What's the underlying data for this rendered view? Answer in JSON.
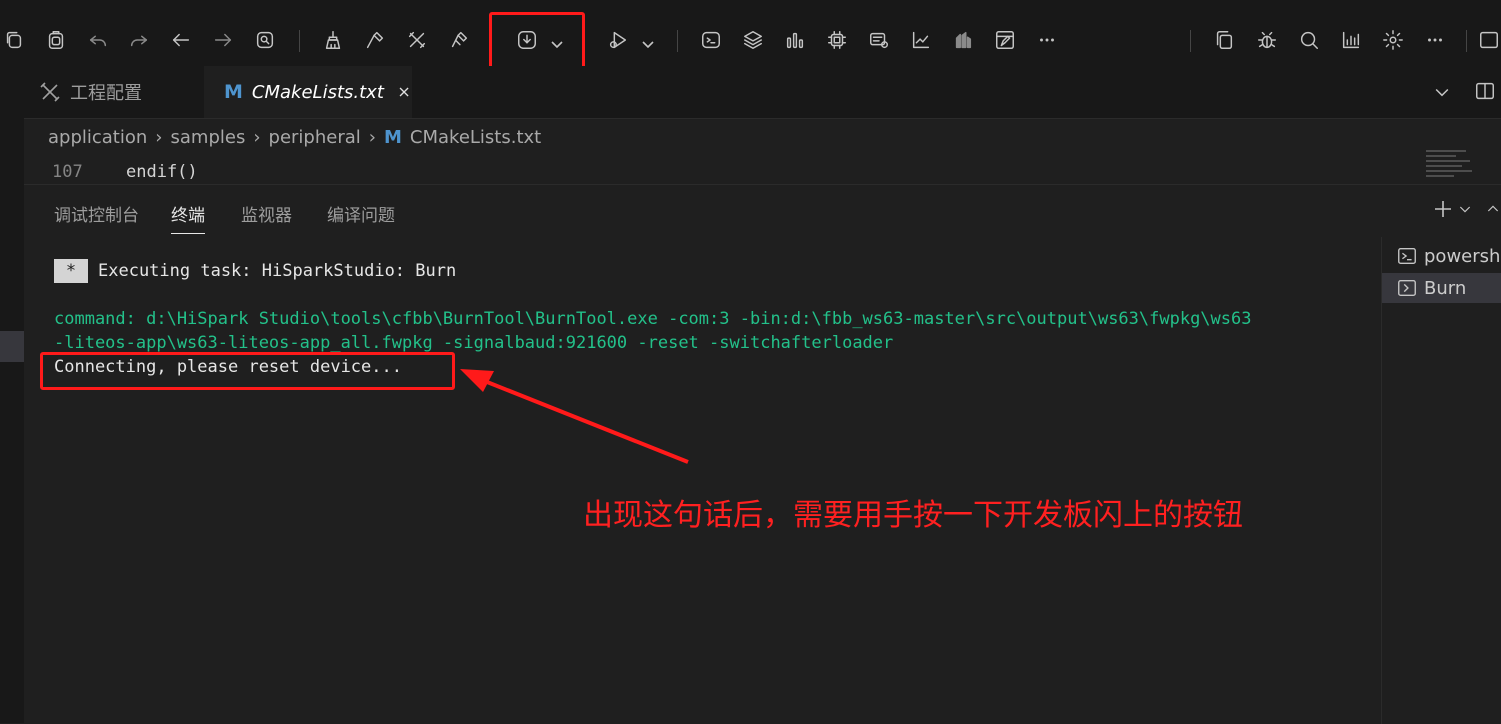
{
  "toolbar": {
    "icons_left": [
      "copy-icon",
      "paste-icon",
      "undo-icon",
      "redo-icon",
      "back-arrow-icon",
      "forward-arrow-icon",
      "find-in-files-icon"
    ],
    "icons_build": [
      "clean-icon",
      "build-icon",
      "rebuild-icon",
      "build-all-icon"
    ],
    "burn_button": "burn-download-icon",
    "debug_button": "debug-run-icon",
    "icons_tools": [
      "terminal-icon",
      "stack-icon",
      "chart-bars-icon",
      "chip-icon",
      "device-config-icon",
      "trend-icon",
      "memory-icon",
      "editor-icon",
      "more-icon"
    ],
    "icons_right": [
      "duplicate-icon",
      "bug-icon",
      "search-icon",
      "stats-icon",
      "gear-icon",
      "more-icon",
      "panel-icon"
    ]
  },
  "tabs": [
    {
      "label": "工程配置",
      "icon": "tools-icon",
      "active": false
    },
    {
      "label": "CMakeLists.txt",
      "icon": "M",
      "active": true
    }
  ],
  "breadcrumb": [
    "application",
    "samples",
    "peripheral",
    "CMakeLists.txt"
  ],
  "breadcrumb_file_icon": "M",
  "editor": {
    "line_number": "107",
    "code": "endif()"
  },
  "panel": {
    "tabs": [
      "调试控制台",
      "终端",
      "监视器",
      "编译问题"
    ],
    "active_tab": "终端"
  },
  "terminal": {
    "task_badge": "*",
    "task_line": "Executing task: HiSparkStudio: Burn",
    "command_line1": "command: d:\\HiSpark Studio\\tools\\cfbb\\BurnTool\\BurnTool.exe -com:3 -bin:d:\\fbb_ws63-master\\src\\output\\ws63\\fwpkg\\ws63",
    "command_line2": "-liteos-app\\ws63-liteos-app_all.fwpkg -signalbaud:921600 -reset -switchafterloader",
    "status_line": "Connecting, please reset device..."
  },
  "terminal_list": [
    {
      "label": "powershell",
      "active": false
    },
    {
      "label": "Burn",
      "active": true
    }
  ],
  "annotation": {
    "text": "出现这句话后，需要用手按一下开发板闪上的按钮",
    "color": "#ff2020"
  },
  "colors": {
    "highlight": "#ff1a1a",
    "terminal_green": "#23c18a",
    "background": "#1f1f1f",
    "toolbar": "#181818"
  }
}
